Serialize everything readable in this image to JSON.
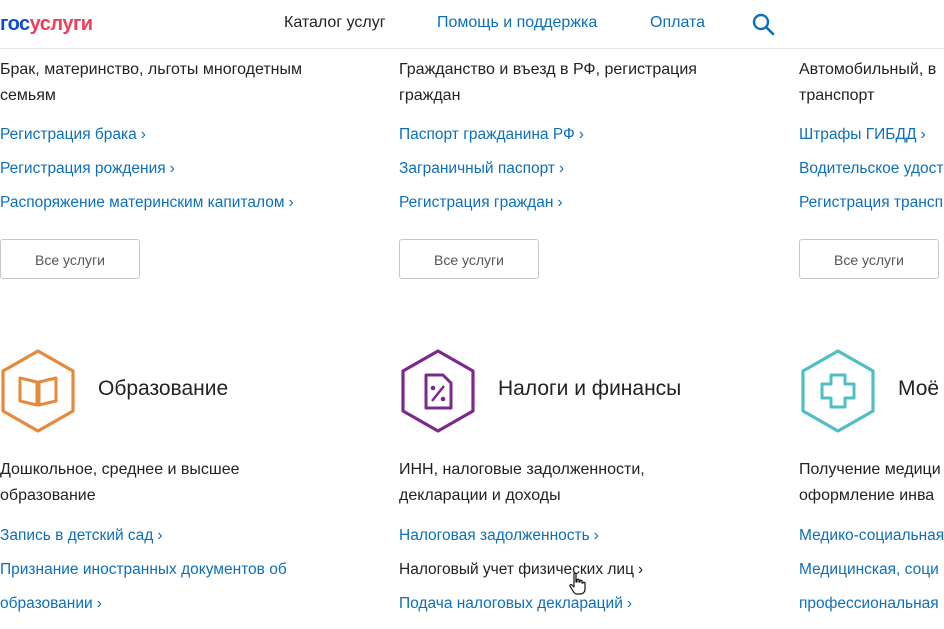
{
  "header": {
    "logo_part1": "гос",
    "logo_part2": "услуги",
    "nav": [
      "Каталог услуг",
      "Помощь и поддержка",
      "Оплата"
    ]
  },
  "top_categories": [
    {
      "desc_lines": [
        "Брак, материнство, льготы многодетным",
        "семьям"
      ],
      "links": [
        "Регистрация брака",
        "Регистрация рождения",
        "Распоряжение материнским капиталом"
      ],
      "button": "Все услуги"
    },
    {
      "desc_lines": [
        "Гражданство и въезд в РФ, регистрация",
        "граждан"
      ],
      "links": [
        "Паспорт гражданина РФ",
        "Заграничный паспорт",
        "Регистрация граждан"
      ],
      "button": "Все услуги"
    },
    {
      "desc_lines": [
        "Автомобильный, в",
        "транспорт"
      ],
      "links": [
        "Штрафы ГИБДД",
        "Водительское удост",
        "Регистрация трансп"
      ],
      "button": "Все услуги"
    }
  ],
  "bottom_categories": [
    {
      "title": "Образование",
      "icon": "book-icon",
      "color": "#e5893a",
      "desc_lines": [
        "Дошкольное, среднее и высшее",
        "образование"
      ],
      "links": [
        "Запись в детский сад",
        "Признание иностранных документов об",
        "образовании"
      ]
    },
    {
      "title": "Налоги и финансы",
      "icon": "tax-document-icon",
      "color": "#7b2a8c",
      "desc_lines": [
        "ИНН, налоговые задолженности,",
        "декларации и доходы"
      ],
      "links": [
        "Налоговая задолженность",
        "Налоговый учет физических лиц",
        "Подача налоговых деклараций"
      ]
    },
    {
      "title": "Моё",
      "icon": "medical-cross-icon",
      "color": "#4fbfc6",
      "desc_lines": [
        "Получение медици",
        "оформление инва"
      ],
      "links": [
        "Медико-социальная",
        "Медицинская, соци",
        "профессиональная"
      ]
    }
  ]
}
